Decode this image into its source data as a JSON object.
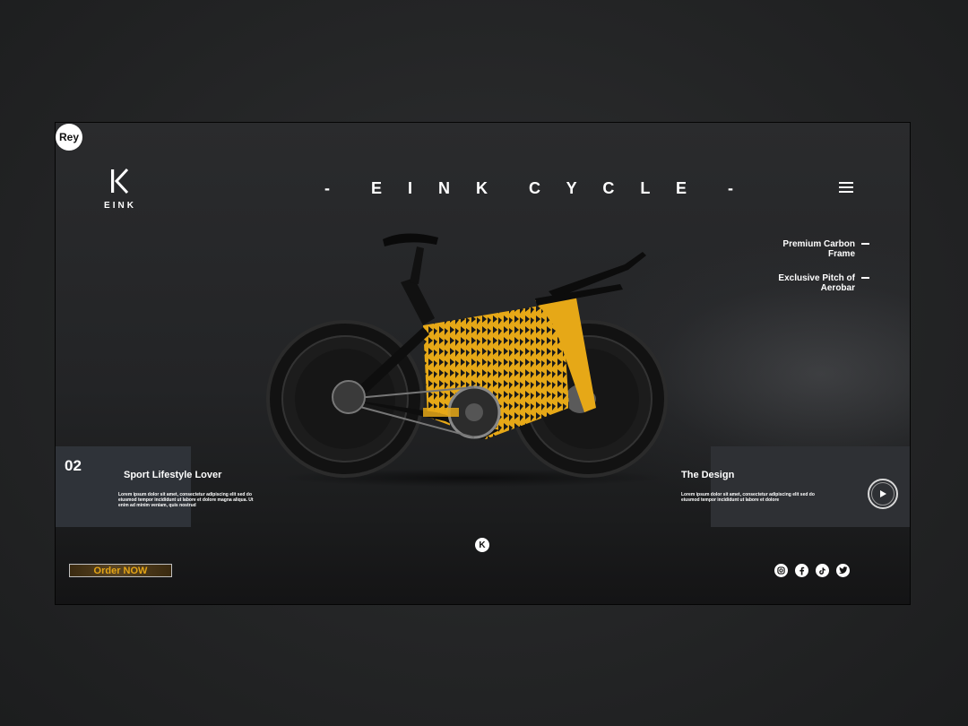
{
  "badge": {
    "label": "Rey"
  },
  "logo": {
    "mark": "K",
    "text": "EINK"
  },
  "brand": {
    "title": "-  E I N K  C Y C L E  -"
  },
  "features": [
    {
      "label": "Premium Carbon Frame"
    },
    {
      "label": "Exclusive Pitch of Aerobar"
    }
  ],
  "section_left": {
    "number": "02",
    "title": "Sport Lifestyle Lover",
    "body": "Lorem ipsum dolor sit amet, consectetur adipiscing elit sed do eiusmod tempor incididunt ut labore et dolore magna aliqua. Ut enim ad minim veniam, quis nostrud"
  },
  "section_right": {
    "title": "The Design",
    "body": "Lorem ipsum dolor sit amet, consectetur adipiscing elit sed do eiusmod tempor incididunt ut labore et dolore"
  },
  "cta": {
    "order_label": "Order NOW"
  },
  "footer": {
    "mini_logo": "K"
  },
  "colors": {
    "accent": "#e5a516",
    "frame": "#e6a817",
    "background": "#242526"
  },
  "icons": [
    "instagram-icon",
    "facebook-icon",
    "tiktok-icon",
    "twitter-icon",
    "play-icon",
    "menu-icon"
  ]
}
